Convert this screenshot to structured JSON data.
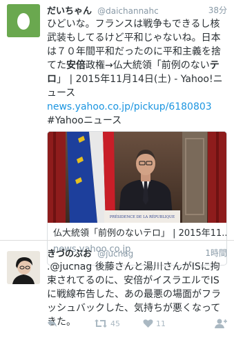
{
  "tweets": [
    {
      "name": "だいちゃん",
      "handle": "@daichannahc",
      "time": "38分",
      "text_parts": {
        "p1": "ひどいな。フランスは戦争もできるし核武装もしてるけど平和じゃないね。日本は７０年間平和だったのに平和主義を捨てた",
        "p2": "安倍",
        "p3": "政権→仏大統領「前例のない",
        "p4": "テロ",
        "p5": "」 | 2015年11月14日(土) - Yahoo!ニュース"
      },
      "link_url": "news.yahoo.co.jp/pickup/6180803",
      "hashtag": "#Yahooニュース",
      "card": {
        "podium_text": "PRÉSIDENCE DE LA RÉPUBLIQUE",
        "title": "仏大統領「前例のないテロ」 | 2015年11...",
        "domain": "news.yahoo.co.jp"
      }
    },
    {
      "name": "きづのぶお",
      "handle": "@jucnag",
      "time": "1時間",
      "text": ".@jucnag 後藤さんと湯川さんがISに拘束されてるのに、安倍がイスラエルでISに戦線布告した、あの最悪の場面がフラッシュバックした、気持ちが悪くなってきた。",
      "retweets": "45",
      "likes": "11"
    }
  ],
  "icons": {
    "reply": "reply-icon",
    "retweet": "retweet-icon",
    "like": "heart-icon",
    "follow": "follow-icon",
    "default_avatar": "egg-avatar-icon"
  },
  "colors": {
    "default_avatar_bg": "#6aa84f",
    "link": "#1b95e0",
    "muted": "#8899a6"
  }
}
